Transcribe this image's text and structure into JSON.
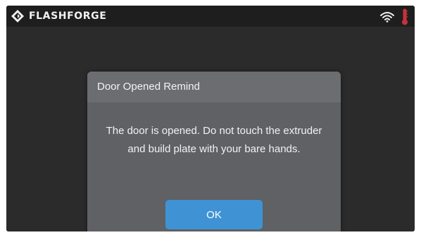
{
  "topbar": {
    "brand": "FLASHFORGE",
    "logo_icon": "flashforge-logo-icon",
    "wifi_icon": "wifi-icon",
    "temperature_icon": "thermometer-icon"
  },
  "dialog": {
    "title": "Door Opened Remind",
    "message": "The door is opened. Do not touch the extruder and build plate with your bare hands.",
    "ok_label": "OK"
  },
  "colors": {
    "screen_background": "#2b2b2b",
    "topbar_background": "#1e1e1e",
    "dialog_background": "#5f6164",
    "dialog_header": "#6b6d70",
    "button": "#3f93d4",
    "thermometer": "#c8323c"
  }
}
